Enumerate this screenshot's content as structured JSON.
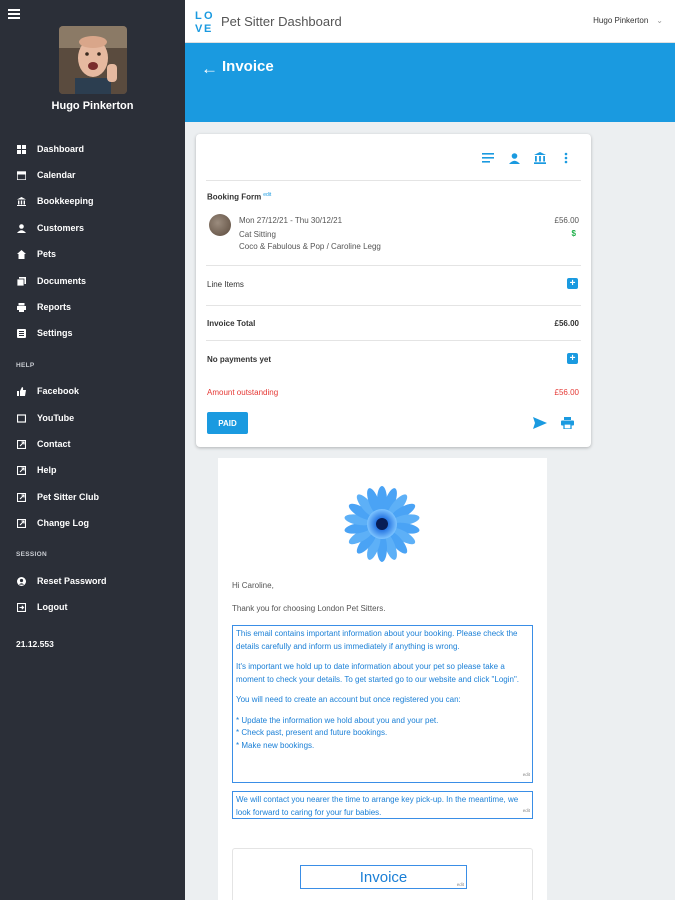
{
  "sidebar": {
    "user_name": "Hugo Pinkerton",
    "nav": [
      {
        "label": "Dashboard",
        "icon": "dashboard-icon"
      },
      {
        "label": "Calendar",
        "icon": "calendar-icon"
      },
      {
        "label": "Bookkeeping",
        "icon": "bank-icon"
      },
      {
        "label": "Customers",
        "icon": "person-icon"
      },
      {
        "label": "Pets",
        "icon": "paw-icon"
      },
      {
        "label": "Documents",
        "icon": "documents-icon"
      },
      {
        "label": "Reports",
        "icon": "reports-icon"
      },
      {
        "label": "Settings",
        "icon": "settings-icon"
      }
    ],
    "help_label": "HELP",
    "help": [
      {
        "label": "Facebook",
        "icon": "thumbs-up-icon"
      },
      {
        "label": "YouTube",
        "icon": "video-icon"
      },
      {
        "label": "Contact",
        "icon": "external-link-icon"
      },
      {
        "label": "Help",
        "icon": "external-link-icon"
      },
      {
        "label": "Pet Sitter Club",
        "icon": "external-link-icon"
      },
      {
        "label": "Change Log",
        "icon": "external-link-icon"
      }
    ],
    "session_label": "SESSION",
    "session": [
      {
        "label": "Reset Password",
        "icon": "account-circle-icon"
      },
      {
        "label": "Logout",
        "icon": "logout-icon"
      }
    ],
    "version": "21.12.553"
  },
  "topbar": {
    "title": "Pet Sitter Dashboard",
    "user": "Hugo Pinkerton",
    "logo_letters": [
      "L",
      "O",
      "V",
      "E"
    ]
  },
  "header": {
    "title": "Invoice"
  },
  "invoice": {
    "booking_form_label": "Booking Form",
    "booking_edit": "edit",
    "booking_dates": "Mon 27/12/21 - Thu 30/12/21",
    "booking_service": "Cat Sitting",
    "booking_pets": "Coco & Fabulous & Pop / Caroline Legg",
    "booking_price": "£56.00",
    "booking_currency": "$",
    "line_items_label": "Line Items",
    "invoice_total_label": "Invoice Total",
    "invoice_total_value": "£56.00",
    "payments_label": "No payments yet",
    "outstanding_label": "Amount outstanding",
    "outstanding_value": "£56.00",
    "paid_button": "PAID"
  },
  "email": {
    "greeting": "Hi Caroline,",
    "thanks": "Thank you for choosing London Pet Sitters.",
    "para1": "This email contains important information about your booking. Please check the details carefully and inform us immediately if anything is wrong.",
    "para2": "It's important we hold up to date information about your pet so please take a moment to check your details. To get started go to our website and click \"Login\".",
    "para3": "You will need to create an account but once registered you can:",
    "bullets": [
      "* Update the information we hold about you and your pet.",
      "* Check past, present and future bookings.",
      "* Make new bookings."
    ],
    "para4": "We will contact you nearer the time to arrange key pick-up. In the meantime, we look forward to caring for your fur babies.",
    "edit_tag": "edit",
    "invoice_heading": "Invoice"
  },
  "colors": {
    "sidebar_bg": "#2b2f38",
    "accent": "#1a9ae0",
    "alert": "#e53935",
    "success": "#1fb04a"
  }
}
